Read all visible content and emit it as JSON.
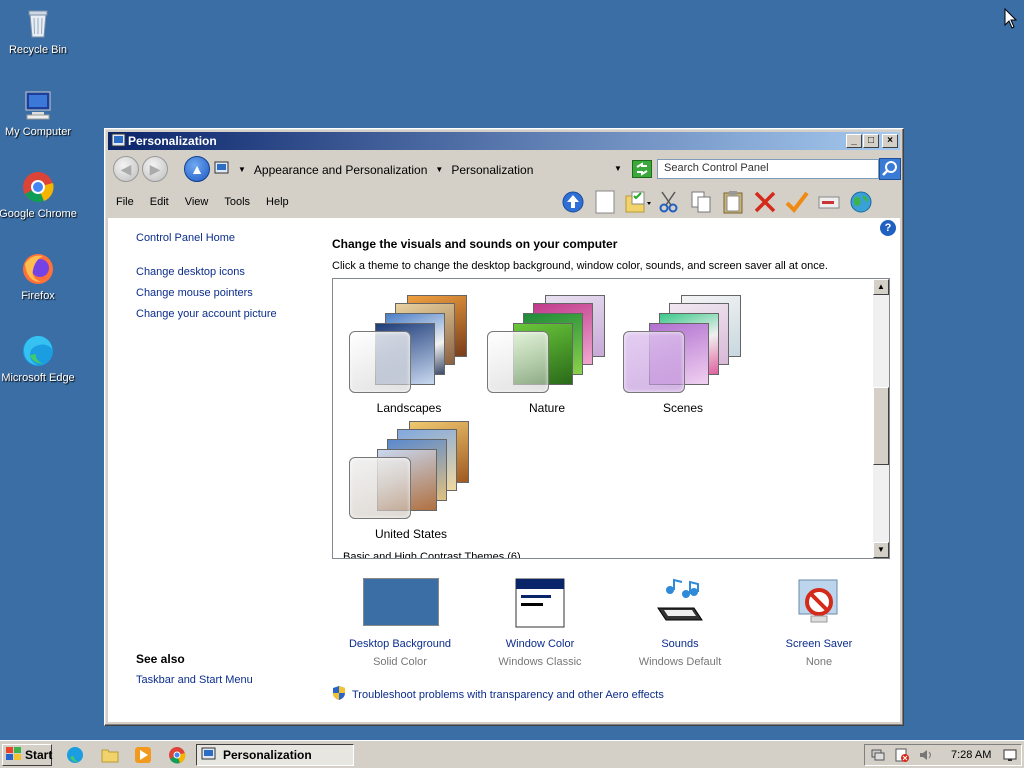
{
  "desktop": {
    "icons": [
      {
        "label": "Recycle Bin",
        "icon": "recycle-bin-icon"
      },
      {
        "label": "My Computer",
        "icon": "computer-icon"
      },
      {
        "label": "Google Chrome",
        "icon": "chrome-icon"
      },
      {
        "label": "Firefox",
        "icon": "firefox-icon"
      },
      {
        "label": "Microsoft Edge",
        "icon": "edge-icon"
      }
    ],
    "background_color": "#3a6ea5"
  },
  "window": {
    "title": "Personalization",
    "controls": {
      "minimize": "_",
      "maximize": "□",
      "close": "×"
    },
    "address": {
      "crumbs": [
        "Appearance and Personalization",
        "Personalization"
      ]
    },
    "search": {
      "placeholder": "Search Control Panel"
    },
    "menu": [
      "File",
      "Edit",
      "View",
      "Tools",
      "Help"
    ],
    "help": "?"
  },
  "leftnav": {
    "home": "Control Panel Home",
    "links": [
      "Change desktop icons",
      "Change mouse pointers",
      "Change your account picture"
    ],
    "see_also": {
      "header": "See also",
      "links": [
        "Taskbar and Start Menu"
      ]
    }
  },
  "main": {
    "title": "Change the visuals and sounds on your computer",
    "subtitle": "Click a theme to change the desktop background, window color, sounds, and screen saver all at once.",
    "themes": [
      "Landscapes",
      "Nature",
      "Scenes",
      "United States"
    ],
    "partial_section_label": "Basic and High Contrast Themes (6)",
    "bottom": [
      {
        "title": "Desktop Background",
        "value": "Solid Color"
      },
      {
        "title": "Window Color",
        "value": "Windows Classic"
      },
      {
        "title": "Sounds",
        "value": "Windows Default"
      },
      {
        "title": "Screen Saver",
        "value": "None"
      }
    ],
    "troubleshoot": "Troubleshoot problems with transparency and other Aero effects"
  },
  "taskbar": {
    "start": "Start",
    "task": "Personalization",
    "clock": "7:28 AM"
  }
}
